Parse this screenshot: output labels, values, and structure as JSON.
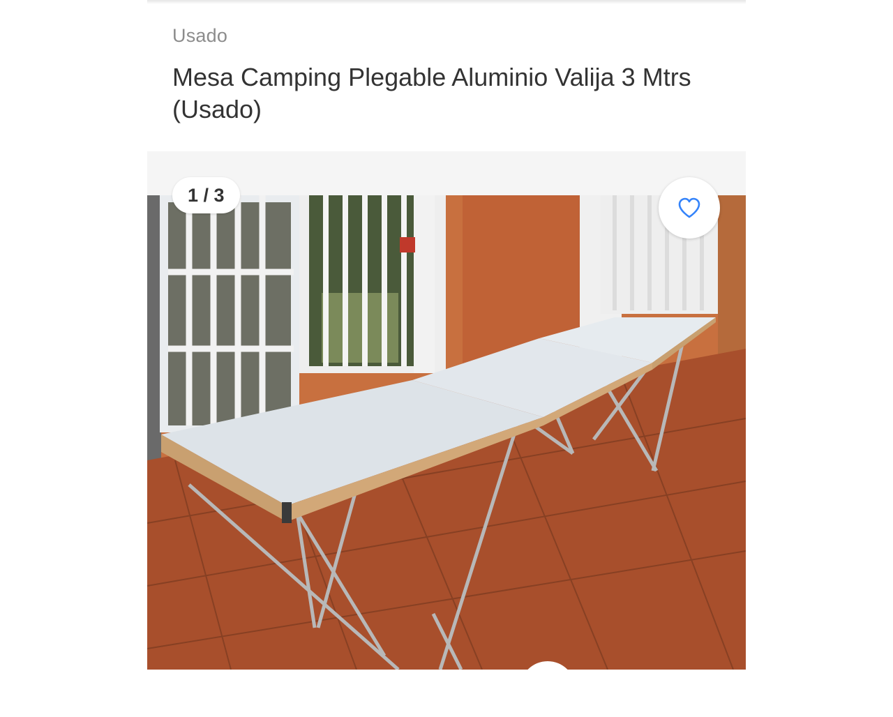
{
  "product": {
    "condition": "Usado",
    "title": "Mesa Camping Plegable Aluminio Valija 3 Mtrs (Usado)"
  },
  "gallery": {
    "counter": "1 / 3",
    "current": 1,
    "total": 3,
    "favorite_icon": "heart-outline-icon",
    "accent_color": "#3483fa"
  }
}
